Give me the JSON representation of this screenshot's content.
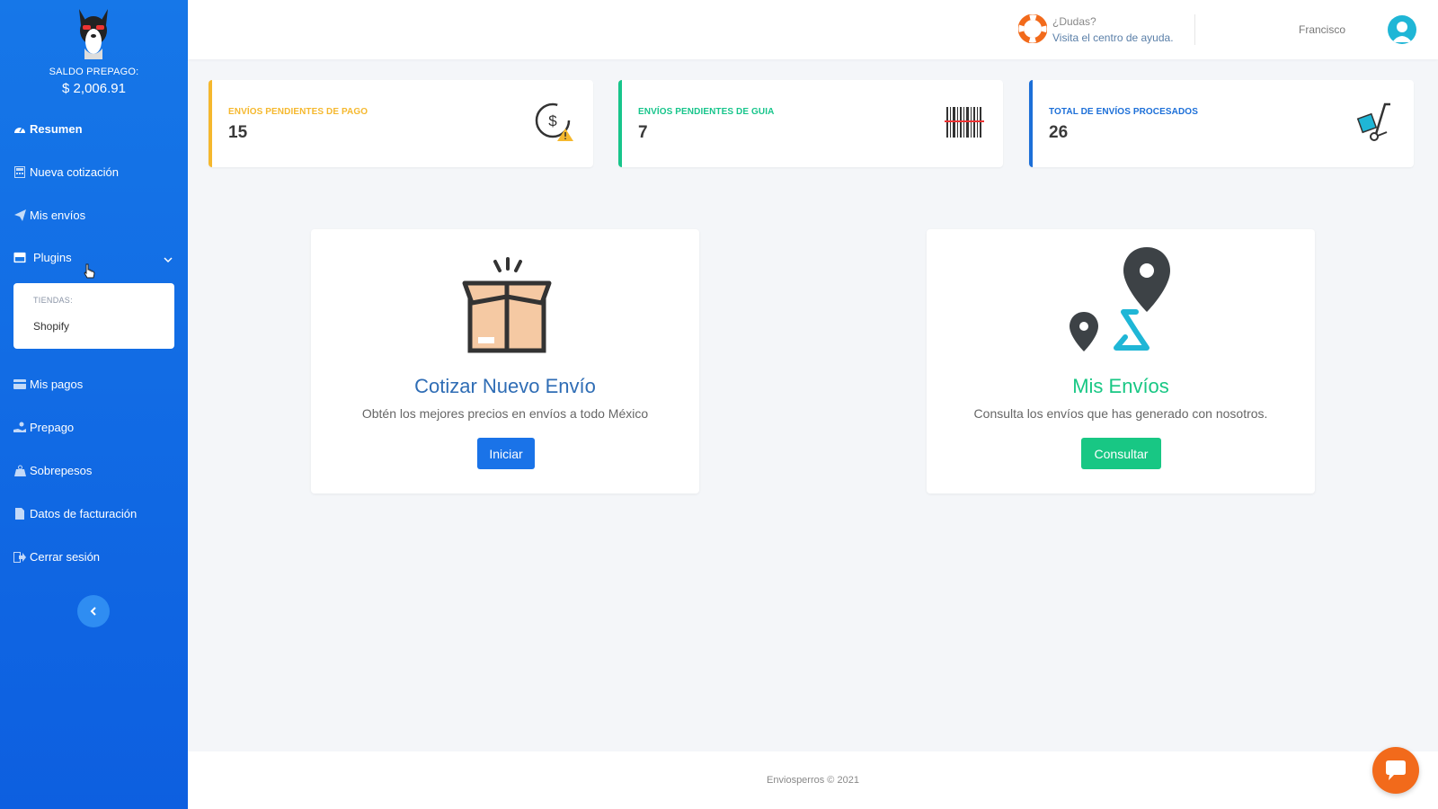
{
  "sidebar": {
    "balance_label": "SALDO PREPAGO:",
    "balance_value": "$ 2,006.91",
    "items": [
      {
        "label": "Resumen",
        "icon": "dashboard-icon",
        "active": true
      },
      {
        "label": "Nueva cotización",
        "icon": "calculator-icon"
      },
      {
        "label": "Mis envíos",
        "icon": "paper-plane-icon"
      },
      {
        "label": "Plugins",
        "icon": "store-icon",
        "expanded": true
      },
      {
        "label": "Mis pagos",
        "icon": "credit-card-icon"
      },
      {
        "label": "Prepago",
        "icon": "hand-coin-icon"
      },
      {
        "label": "Sobrepesos",
        "icon": "weight-icon"
      },
      {
        "label": "Datos de facturación",
        "icon": "file-icon"
      },
      {
        "label": "Cerrar sesión",
        "icon": "sign-out-icon"
      }
    ],
    "submenu": {
      "header": "TIENDAS:",
      "items": [
        "Shopify"
      ]
    }
  },
  "topbar": {
    "help_question": "¿Dudas?",
    "help_link": "Visita el centro de ayuda.",
    "username": "Francisco"
  },
  "stats": [
    {
      "label": "ENVÍOS PENDIENTES DE PAGO",
      "value": "15",
      "color": "#f5b82e",
      "icon": "dollar-warning-icon"
    },
    {
      "label": "ENVÍOS PENDIENTES DE GUIA",
      "value": "7",
      "color": "#17c58b",
      "icon": "barcode-icon"
    },
    {
      "label": "TOTAL DE ENVÍOS PROCESADOS",
      "value": "26",
      "color": "#1c6fd8",
      "icon": "hand-truck-icon"
    }
  ],
  "cards": [
    {
      "title": "Cotizar Nuevo Envío",
      "description": "Obtén los mejores precios en envíos a todo México",
      "button": "Iniciar",
      "color": "#1a73e8"
    },
    {
      "title": "Mis Envíos",
      "description": "Consulta los envíos que has generado con nosotros.",
      "button": "Consultar",
      "color": "#18c784"
    }
  ],
  "footer": {
    "text": "Enviosperros © 2021"
  }
}
